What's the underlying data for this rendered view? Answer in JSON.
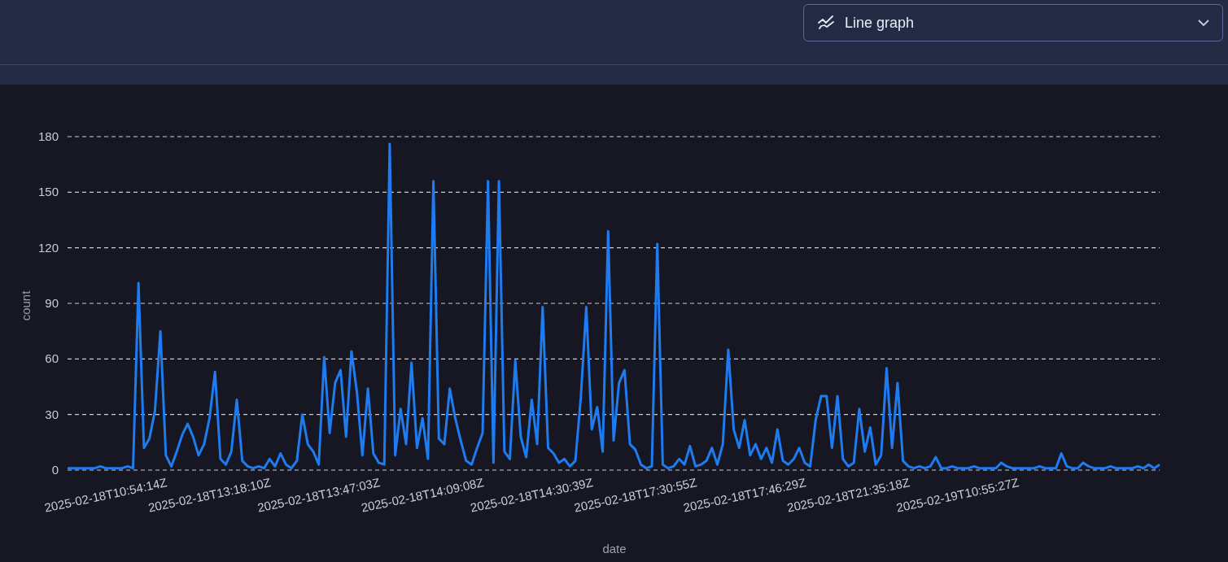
{
  "view_select": {
    "value": "Line graph"
  },
  "chart": {
    "chart_data": {
      "type": "line",
      "xlabel": "date",
      "ylabel": "count",
      "ylim": [
        0,
        180
      ],
      "yticks": [
        0,
        30,
        60,
        90,
        120,
        150,
        180
      ],
      "grid": true,
      "categories": [
        null,
        null,
        null,
        null,
        null,
        null,
        null,
        "2025-02-18T10:54:14Z",
        null,
        null,
        null,
        null,
        null,
        null,
        null,
        null,
        null,
        null,
        null,
        null,
        null,
        null,
        null,
        null,
        null,
        null,
        "2025-02-18T13:18:10Z",
        null,
        null,
        null,
        null,
        null,
        null,
        null,
        null,
        null,
        null,
        null,
        null,
        null,
        null,
        null,
        null,
        null,
        null,
        null,
        "2025-02-18T13:47:03Z",
        null,
        null,
        null,
        null,
        null,
        null,
        null,
        null,
        null,
        null,
        null,
        null,
        null,
        null,
        null,
        null,
        null,
        null,
        "2025-02-18T14:09:08Z",
        null,
        null,
        null,
        null,
        null,
        null,
        null,
        null,
        null,
        null,
        null,
        null,
        null,
        null,
        null,
        null,
        null,
        null,
        null,
        "2025-02-18T14:30:39Z",
        null,
        null,
        null,
        null,
        null,
        null,
        null,
        null,
        null,
        null,
        null,
        null,
        null,
        null,
        null,
        null,
        null,
        null,
        "2025-02-18T17:30:55Z",
        null,
        null,
        null,
        null,
        null,
        null,
        null,
        null,
        null,
        null,
        null,
        null,
        null,
        null,
        null,
        null,
        null,
        null,
        null,
        "2025-02-18T17:46:29Z",
        null,
        null,
        null,
        null,
        null,
        null,
        null,
        null,
        null,
        null,
        null,
        null,
        null,
        null,
        null,
        null,
        null,
        null,
        "2025-02-18T21:35:18Z",
        null,
        null,
        null,
        null,
        null,
        null,
        null,
        null,
        null,
        null,
        null,
        null,
        null,
        null,
        null,
        null,
        null,
        null,
        null,
        "2025-02-19T10:55:27Z",
        null,
        null,
        null,
        null,
        null,
        null,
        null,
        null,
        null,
        null,
        null,
        null,
        null,
        null,
        null,
        null,
        null,
        null,
        null,
        null,
        null,
        null,
        null,
        null,
        null,
        null,
        null,
        null,
        null,
        null,
        null,
        null,
        null,
        null,
        null,
        null,
        null
      ],
      "series": [
        {
          "color": "#1f7bf0",
          "values": [
            1,
            1,
            1,
            1,
            1,
            1,
            2,
            1,
            1,
            1,
            1,
            2,
            1,
            101,
            12,
            17,
            32,
            75,
            8,
            2,
            10,
            19,
            25,
            18,
            8,
            14,
            28,
            53,
            6,
            3,
            10,
            38,
            5,
            2,
            1,
            2,
            1,
            6,
            2,
            9,
            3,
            1,
            5,
            30,
            14,
            10,
            3,
            61,
            20,
            47,
            54,
            18,
            64,
            42,
            8,
            44,
            9,
            4,
            3,
            176,
            8,
            33,
            14,
            58,
            12,
            28,
            6,
            156,
            17,
            14,
            44,
            28,
            16,
            5,
            3,
            12,
            20,
            156,
            4,
            156,
            10,
            6,
            59,
            18,
            7,
            38,
            14,
            88,
            12,
            9,
            4,
            6,
            2,
            5,
            39,
            88,
            22,
            34,
            10,
            129,
            16,
            47,
            54,
            14,
            11,
            3,
            1,
            2,
            122,
            3,
            1,
            2,
            6,
            3,
            13,
            2,
            3,
            5,
            12,
            3,
            14,
            65,
            22,
            12,
            27,
            8,
            14,
            6,
            12,
            4,
            22,
            5,
            3,
            6,
            12,
            4,
            2,
            27,
            40,
            40,
            12,
            40,
            6,
            2,
            4,
            33,
            10,
            23,
            3,
            8,
            55,
            12,
            47,
            5,
            2,
            1,
            2,
            1,
            2,
            7,
            1,
            1,
            2,
            1,
            1,
            1,
            2,
            1,
            1,
            1,
            1,
            4,
            2,
            1,
            1,
            1,
            1,
            1,
            2,
            1,
            1,
            1,
            9,
            2,
            1,
            1,
            4,
            2,
            1,
            1,
            1,
            2,
            1,
            1,
            1,
            1,
            2,
            1,
            3,
            1,
            3
          ]
        }
      ]
    }
  }
}
